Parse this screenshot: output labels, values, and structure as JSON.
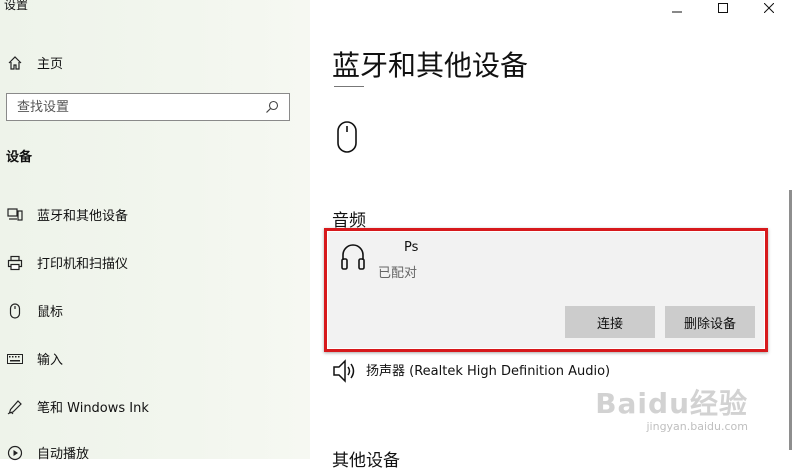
{
  "window": {
    "title": "设置"
  },
  "sidebar": {
    "home_label": "主页",
    "search_placeholder": "查找设置",
    "section_title": "设备",
    "items": [
      {
        "label": "蓝牙和其他设备",
        "icon": "bluetooth-devices-icon"
      },
      {
        "label": "打印机和扫描仪",
        "icon": "printer-icon"
      },
      {
        "label": "鼠标",
        "icon": "mouse-icon"
      },
      {
        "label": "输入",
        "icon": "keyboard-icon"
      },
      {
        "label": "笔和 Windows Ink",
        "icon": "pen-icon"
      },
      {
        "label": "自动播放",
        "icon": "autoplay-icon"
      }
    ]
  },
  "main": {
    "title": "蓝牙和其他设备",
    "audio_heading": "音频",
    "selected_device": {
      "name": "Ps",
      "status": "已配对",
      "icon": "headphones-icon"
    },
    "buttons": {
      "connect": "连接",
      "remove": "删除设备"
    },
    "speaker": {
      "label": "扬声器 (Realtek High Definition Audio)",
      "icon": "speaker-icon"
    },
    "other_heading": "其他设备"
  },
  "watermark": {
    "logo": "Baidu经验",
    "url": "jingyan.baidu.com"
  },
  "colors": {
    "highlight": "#d7191c",
    "button": "#cccccc",
    "card": "#f2f2f2"
  }
}
